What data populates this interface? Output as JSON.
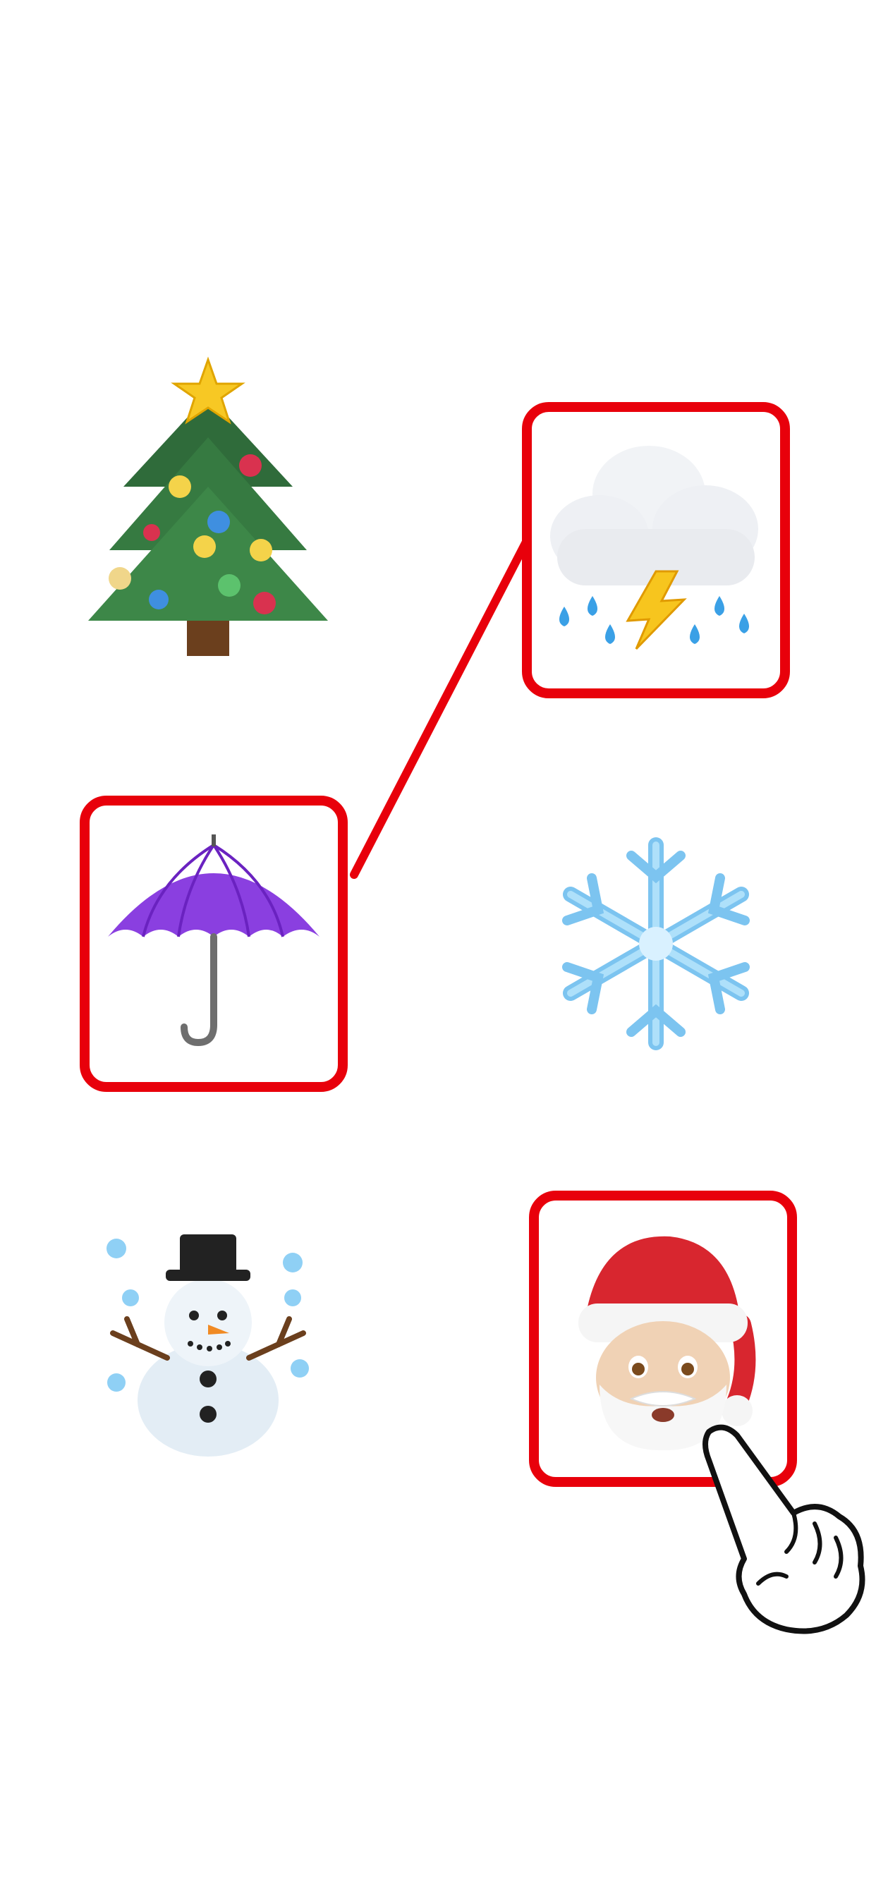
{
  "board": {
    "tiles": [
      {
        "id": "tile-tree",
        "emoji": "christmas-tree",
        "selected": false
      },
      {
        "id": "tile-storm",
        "emoji": "cloud-with-lightning-and-rain",
        "selected": true
      },
      {
        "id": "tile-umbrella",
        "emoji": "umbrella",
        "selected": true
      },
      {
        "id": "tile-snowflake",
        "emoji": "snowflake",
        "selected": false
      },
      {
        "id": "tile-snowman",
        "emoji": "snowman",
        "selected": false
      },
      {
        "id": "tile-santa",
        "emoji": "santa-claus",
        "selected": true
      }
    ],
    "connections": [
      {
        "from": "tile-umbrella",
        "to": "tile-storm"
      }
    ],
    "pointer": {
      "icon": "pointing-hand-icon",
      "target": "tile-santa"
    }
  },
  "colors": {
    "highlight": "#e8000b",
    "background": "#ffffff"
  }
}
